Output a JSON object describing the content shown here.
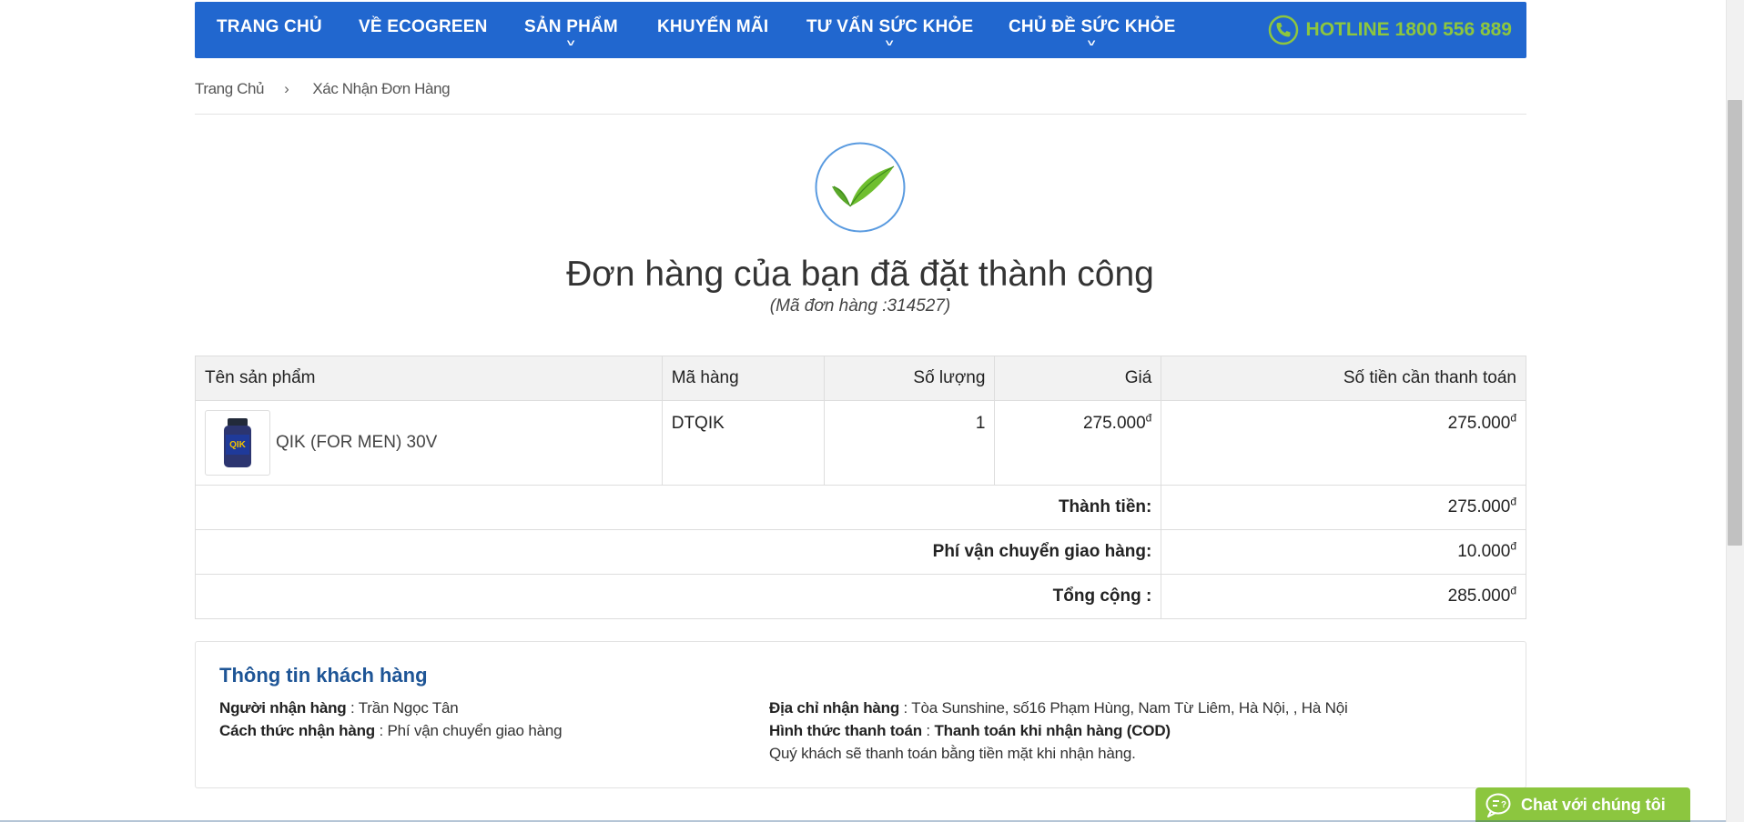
{
  "nav": {
    "items": [
      {
        "label": "TRANG CHỦ",
        "has_dropdown": false
      },
      {
        "label": "VỀ ECOGREEN",
        "has_dropdown": false
      },
      {
        "label": "SẢN PHẨM",
        "has_dropdown": true
      },
      {
        "label": "KHUYẾN MÃI",
        "has_dropdown": false
      },
      {
        "label": "TƯ VẤN SỨC KHỎE",
        "has_dropdown": true
      },
      {
        "label": "CHỦ ĐỀ SỨC KHỎE",
        "has_dropdown": true
      }
    ],
    "hotline": "HOTLINE 1800 556 889",
    "hotline_icon": "phone-icon"
  },
  "breadcrumb": {
    "home": "Trang Chủ",
    "separator": "›",
    "current": "Xác Nhận Đơn Hàng"
  },
  "success": {
    "icon": "check-leaf-icon",
    "title": "Đơn hàng của bạn đã đặt thành công",
    "order_code": "(Mã đơn hàng :314527)"
  },
  "order_table": {
    "headers": [
      "Tên sản phẩm",
      "Mã hàng",
      "Số lượng",
      "Giá",
      "Số tiền cần thanh toán"
    ],
    "items": [
      {
        "name": "QIK (FOR MEN) 30V",
        "code": "DTQIK",
        "quantity": "1",
        "price": "275.000",
        "total": "275.000",
        "thumb_label": "QIK"
      }
    ],
    "currency_symbol": "đ",
    "subtotal_label": "Thành tiền:",
    "subtotal": "275.000",
    "shipping_label": "Phí vận chuyển giao hàng:",
    "shipping": "10.000",
    "grand_total_label": "Tổng cộng :",
    "grand_total": "285.000"
  },
  "customer": {
    "title": "Thông tin khách hàng",
    "recipient_label": "Người nhận hàng",
    "recipient": " : Trần Ngọc Tân",
    "method_label": "Cách thức nhận hàng",
    "method": " : Phí vận chuyển giao hàng",
    "address_label": "Địa chỉ nhận hàng",
    "address": " : Tòa Sunshine, số16 Phạm Hùng, Nam Từ Liêm, Hà Nội, , Hà Nội",
    "payment_label": "Hình thức thanh toán",
    "payment_sep": " : ",
    "payment": "Thanh toán khi nhận hàng (COD)",
    "payment_note": "Quý khách sẽ thanh toán bằng tiền mặt khi nhận hàng."
  },
  "chat": {
    "label": "Chat với chúng tôi",
    "icon": "chat-bubble-icon"
  },
  "colors": {
    "nav_bg": "#2167cf",
    "hotline": "#8dc63f",
    "title_blue": "#1e5596",
    "chat_bg": "#8cc63f"
  }
}
